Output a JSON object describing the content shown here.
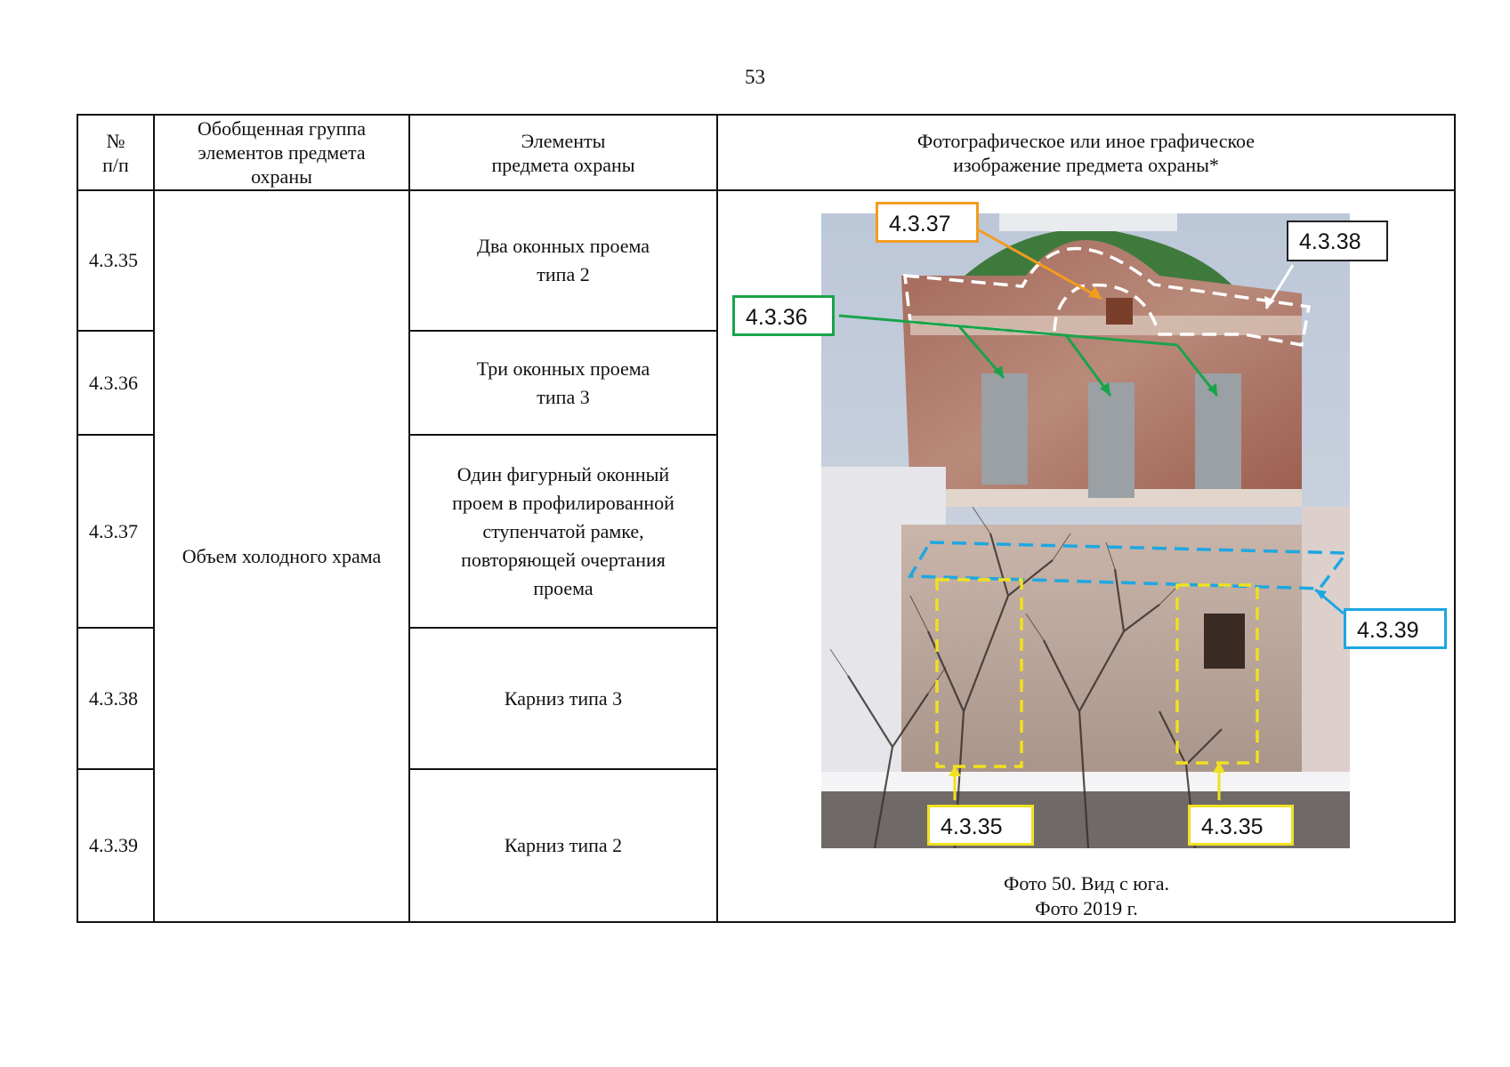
{
  "page_number": "53",
  "table": {
    "headers": {
      "col_num": "№\nп/п",
      "col_group": "Обобщенная группа\nэлементов предмета\nохраны",
      "col_elements": "Элементы\nпредмета охраны",
      "col_image": "Фотографическое или иное графическое\nизображение предмета охраны*"
    },
    "group": "Объем холодного храма",
    "rows": [
      {
        "num": "4.3.35",
        "element": "Два оконных проема\nтипа 2"
      },
      {
        "num": "4.3.36",
        "element": "Три оконных проема\nтипа 3"
      },
      {
        "num": "4.3.37",
        "element": "Один фигурный оконный\nпроем в профилированной\nступенчатой рамке,\nповторяющей очертания\nпроема"
      },
      {
        "num": "4.3.38",
        "element": "Карниз типа 3"
      },
      {
        "num": "4.3.39",
        "element": "Карниз типа 2"
      }
    ]
  },
  "photo": {
    "callouts": {
      "c_4337": {
        "label": "4.3.37",
        "color": "#f39c1e"
      },
      "c_4338": {
        "label": "4.3.38",
        "color": "#222222"
      },
      "c_4336": {
        "label": "4.3.36",
        "color": "#1aa34a"
      },
      "c_4339": {
        "label": "4.3.39",
        "color": "#1ea7e1"
      },
      "c_4335a": {
        "label": "4.3.35",
        "color": "#f0e020"
      },
      "c_4335b": {
        "label": "4.3.35",
        "color": "#f0e020"
      }
    },
    "caption_line1": "Фото 50. Вид с юга.",
    "caption_line2": "Фото 2019 г."
  }
}
